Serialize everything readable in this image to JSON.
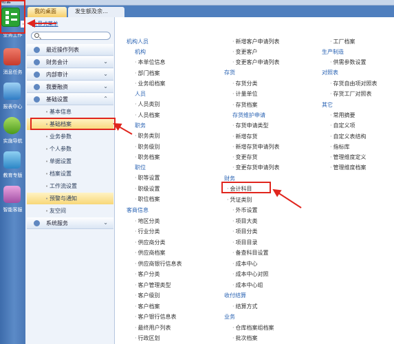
{
  "window": {
    "title": "帐套"
  },
  "dock": {
    "workbench": "业务工作",
    "messages": "消息任务",
    "report": "报表中心",
    "nav": "实施导航",
    "edu": "教育专版",
    "smart": "智能客服"
  },
  "tabs": [
    "我的桌面",
    "发生额及余…"
  ],
  "sidebar": {
    "full_menu": "全景式菜单",
    "search_placeholder": "",
    "groups": [
      {
        "label": "最近操作列表",
        "chev": ""
      },
      {
        "label": "财务会计",
        "chev": "⌄"
      },
      {
        "label": "内部审计",
        "chev": "⌄"
      },
      {
        "label": "我要融资",
        "chev": "⌄"
      },
      {
        "label": "基础设置",
        "chev": "⌃"
      }
    ],
    "subs": [
      "基本信息",
      "基础档案",
      "业务参数",
      "个人参数",
      "单据设置",
      "档案设置",
      "工作流设置",
      "预警与通知",
      "友空间"
    ],
    "system": {
      "label": "系统服务",
      "chev": "⌄"
    }
  },
  "content": {
    "col1": {
      "org": {
        "hd": "机构人员",
        "sub": "机构",
        "items": [
          "本单位信息",
          "部门档案",
          "业务组档案"
        ]
      },
      "person": {
        "hd": "人员",
        "items": [
          "人员类别",
          "人员档案"
        ]
      },
      "duty": {
        "hd": "职务",
        "items": [
          "职务类别",
          "职务级别",
          "职务档案"
        ]
      },
      "pos": {
        "hd": "职位",
        "items": [
          "职等设置",
          "职级设置",
          "职位档案"
        ]
      },
      "cust": {
        "hd": "客商信息",
        "items": [
          "地区分类",
          "行业分类",
          "供应商分类",
          "供应商档案",
          "供应商银行信息表",
          "客户分类",
          "客户管理类型",
          "客户级别",
          "客户档案",
          "客户银行信息表",
          "最终用户列表",
          "行政区划"
        ]
      }
    },
    "col2": {
      "top": [
        "新增客户申请列表",
        "变更客户",
        "变更客户申请列表"
      ],
      "inv": {
        "hd": "存货",
        "items": [
          "存货分类",
          "计量单位",
          "存货档案"
        ]
      },
      "invapply": {
        "hd": "存货维护申请",
        "items": [
          "存货申请类型",
          "新增存货",
          "新增存货申请列表",
          "变更存货",
          "变更存货申请列表"
        ]
      },
      "fin": {
        "hd": "财务",
        "items": [
          "会计科目",
          "凭证类别",
          "外币设置",
          "项目大类",
          "项目分类",
          "项目目录",
          "备查科目设置",
          "成本中心",
          "成本中心对照",
          "成本中心组"
        ]
      },
      "settle": {
        "hd": "收付结算",
        "items": [
          "结算方式"
        ]
      },
      "biz": {
        "hd": "业务",
        "items": [
          "仓库档案组档案",
          "批次档案"
        ]
      }
    },
    "col3": {
      "top": [
        "工厂档案"
      ],
      "mfg": {
        "hd": "生产制造",
        "items": [
          "供需参数设置"
        ]
      },
      "map": {
        "hd": "对照表",
        "items": [
          "存货自由项对照表",
          "存货工厂对照表"
        ]
      },
      "other": {
        "hd": "其它",
        "items": [
          "常用摘要",
          "自定义项",
          "自定义表结构",
          "指标库",
          "管理维度定义",
          "管理维度档案"
        ]
      }
    }
  },
  "colors": {
    "dock": "#4a78b6",
    "accent": "#2a63b3",
    "highlight": "#f8d778",
    "annotation": "#e0251d"
  }
}
